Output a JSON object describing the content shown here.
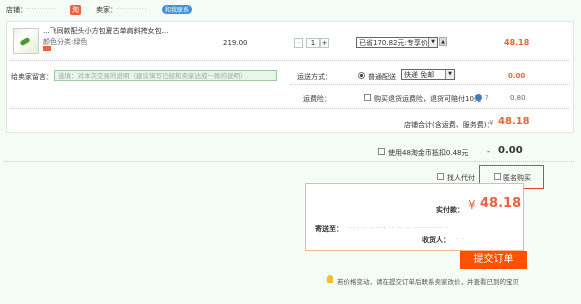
{
  "topbar": {
    "shop_label": "店铺：",
    "shop_name_masked": "··········· ",
    "shop_tag": "淘",
    "seller_label": "卖家：",
    "seller_name_masked": "···········",
    "contact_label": "和我联系"
  },
  "item": {
    "title": "...飞同款配头小方包夏古单肩斜挎女包...",
    "color_spec": "颜色分类:绿色",
    "price": "219.00",
    "quantity": "1",
    "discount_select": "已省170.82元:专享价",
    "subtotal": "48.18"
  },
  "message": {
    "label": "给卖家留言：",
    "placeholder": "选填：对本次交易的说明（建议填写已经和卖家达成一致的说明）"
  },
  "shipping": {
    "label": "运送方式：",
    "option_label": "普通配送",
    "select_value": "快递 免邮",
    "fee": "0.00"
  },
  "insurance": {
    "label": "运费险：",
    "checkbox_label": "购买退货运费险，退货可赔付10元",
    "help": "?",
    "fee": "0.80"
  },
  "shop_total": {
    "label": "店铺合计(含运费、服务费)：",
    "currency": "¥",
    "amount": "48.18"
  },
  "points": {
    "checkbox_label": "使用48淘金币抵扣0.48元",
    "amount": "0.00",
    "minus": "-"
  },
  "options": {
    "proxy_pay": "找人代付",
    "anonymous": "匿名购买"
  },
  "order_summary": {
    "paid_label": "实付款：",
    "currency": "¥",
    "paid_amount": "48.18",
    "ship_to_label": "寄送至：",
    "ship_to_masked": "···· ·· ······ ·· ·· ·· ··········· ·",
    "receiver_label": "收货人：",
    "receiver_masked": "·  ·"
  },
  "submit": {
    "label": "提交订单"
  },
  "notice": {
    "text": "若价格变动，请在提交订单后联系卖家改价，并查看已到的宝贝"
  },
  "colors": {
    "accent": "#ff5100",
    "price_orange": "#e8633b",
    "highlight_red": "#e8402a",
    "page_bg": "#f5fbf5"
  }
}
